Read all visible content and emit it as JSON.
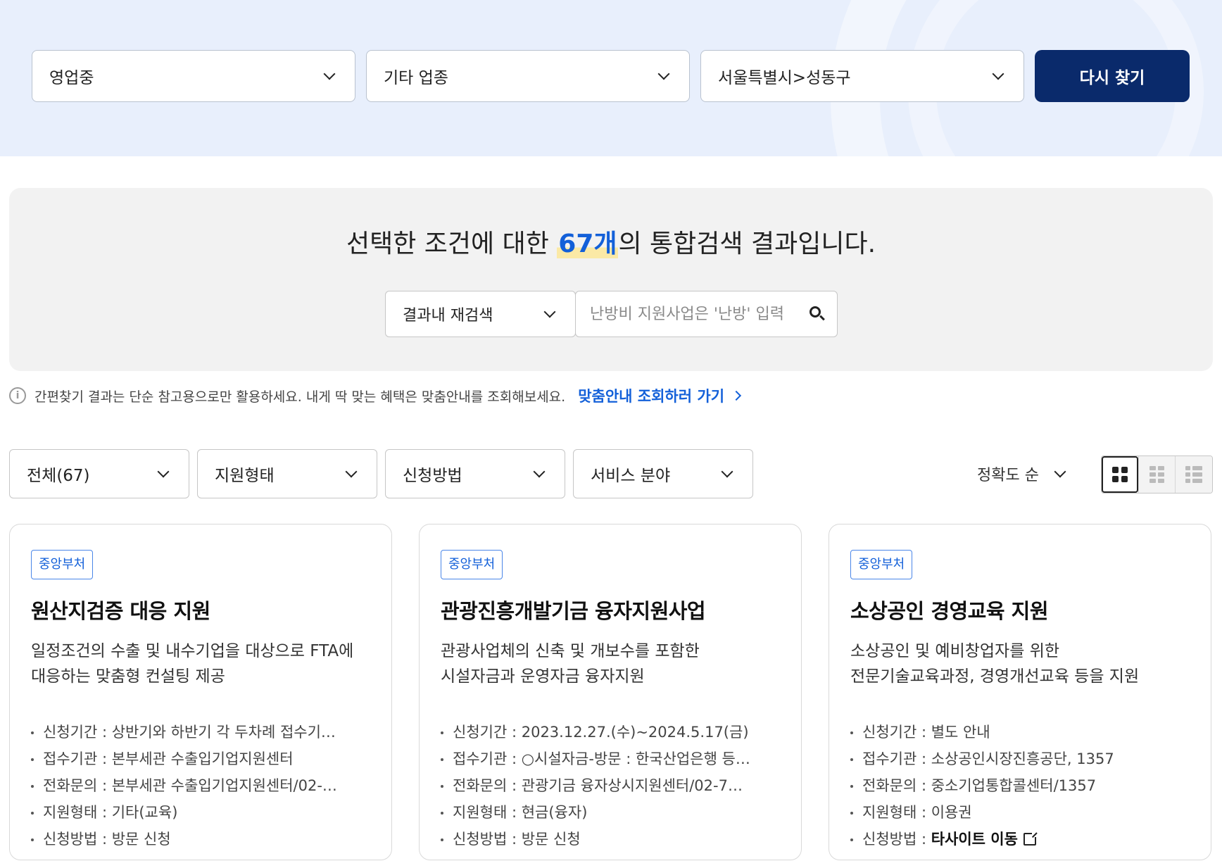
{
  "filters": {
    "status": "영업중",
    "industry": "기타 업종",
    "region": "서울특별시>성동구",
    "search_again_button": "다시 찾기"
  },
  "summary": {
    "headline_prefix": "선택한 조건에 대한 ",
    "count": "67개",
    "headline_suffix": "의 통합검색 결과입니다.",
    "research_select": "결과내 재검색",
    "search_placeholder": "난방비 지원사업은 '난방' 입력"
  },
  "notice": {
    "text": "간편찾기 결과는 단순 참고용으로만 활용하세요. 내게 딱 맞는 혜택은 맞춤안내를 조회해보세요.",
    "link": "맞춤안내 조회하러 가기"
  },
  "list_filters": {
    "all": "전체(67)",
    "support_type": "지원형태",
    "apply_method": "신청방법",
    "service_field": "서비스 분야",
    "sort": "정확도 순"
  },
  "cards": [
    {
      "badge": "중앙부처",
      "title": "원산지검증 대응 지원",
      "desc": "일정조건의 수출 및 내수기업을 대상으로 FTA에\n대응하는 맞춤형 컨설팅 제공",
      "items": [
        {
          "key": "신청기간 : ",
          "value": "상반기와 하반기 각 두차례 접수기…"
        },
        {
          "key": "접수기관 : ",
          "value": "본부세관 수출입기업지원센터"
        },
        {
          "key": "전화문의 : ",
          "value": "본부세관 수출입기업지원센터/02-…"
        },
        {
          "key": "지원형태 : ",
          "value": "기타(교육)"
        },
        {
          "key": "신청방법 : ",
          "value": "방문 신청"
        }
      ]
    },
    {
      "badge": "중앙부처",
      "title": "관광진흥개발기금 융자지원사업",
      "desc": "관광사업체의 신축 및 개보수를 포함한\n시설자금과 운영자금 융자지원",
      "items": [
        {
          "key": "신청기간 : ",
          "value": "2023.12.27.(수)~2024.5.17(금)"
        },
        {
          "key": "접수기관 : ",
          "value": "○시설자금-방문 : 한국산업은행 등…"
        },
        {
          "key": "전화문의 : ",
          "value": "관광기금 융자상시지원센터/02-7…"
        },
        {
          "key": "지원형태 : ",
          "value": "현금(융자)"
        },
        {
          "key": "신청방법 : ",
          "value": "방문 신청"
        }
      ]
    },
    {
      "badge": "중앙부처",
      "title": "소상공인 경영교육 지원",
      "desc": "소상공인 및 예비창업자를 위한\n전문기술교육과정, 경영개선교육 등을 지원",
      "items": [
        {
          "key": "신청기간 : ",
          "value": "별도 안내"
        },
        {
          "key": "접수기관 : ",
          "value": "소상공인시장진흥공단, 1357"
        },
        {
          "key": "전화문의 : ",
          "value": "중소기업통합콜센터/1357"
        },
        {
          "key": "지원형태 : ",
          "value": "이용권"
        },
        {
          "key": "신청방법 : ",
          "value": "타사이트 이동"
        }
      ]
    }
  ],
  "icons": {
    "dropdown": "chevron-down-icon",
    "search": "search-icon",
    "info": "info-icon",
    "link_arrow": "chevron-right-icon",
    "external": "external-link-icon",
    "view_modes": [
      "grid-2x2-icon",
      "grid-3x3-icon",
      "list-icon"
    ]
  },
  "colors": {
    "primary": "#0a2a6b",
    "accent": "#1360d9",
    "highlight": "#fbe9a6",
    "band": "#e8effc"
  }
}
